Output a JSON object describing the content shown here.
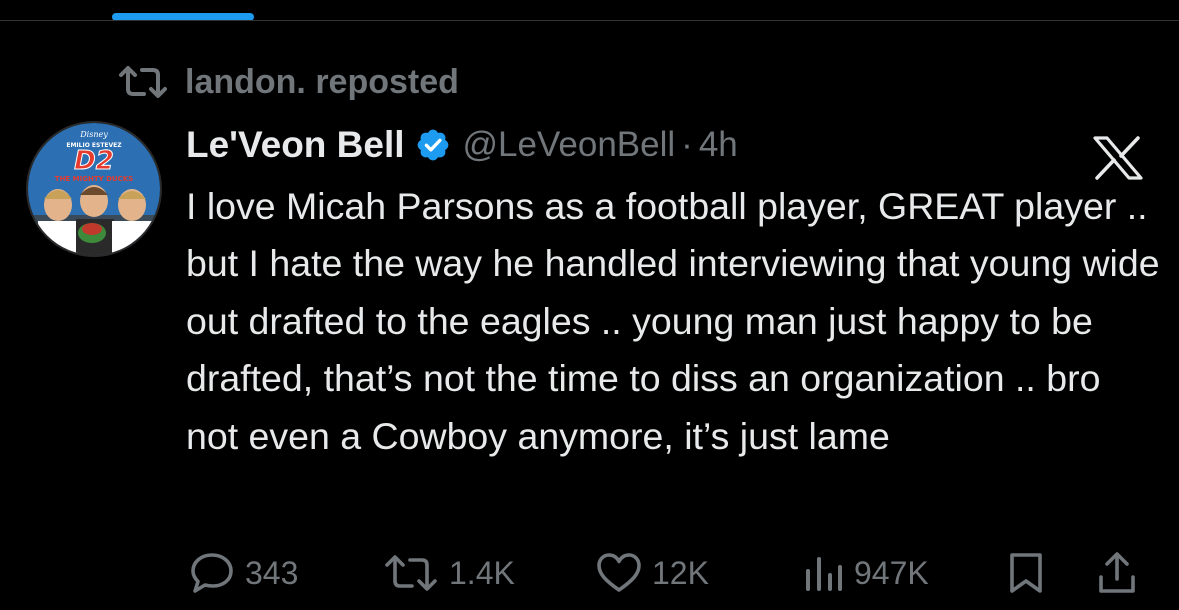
{
  "repost": {
    "text": "landon. reposted"
  },
  "post": {
    "display_name": "Le'Veon Bell",
    "handle": "@LeVeonBell",
    "separator": "·",
    "time": "4h",
    "verified": true,
    "text": "I love Micah Parsons as a football player, GREAT player .. but I hate the way he handled interviewing that young wide out drafted to the eagles .. young man just happy to be drafted, that’s not the time to diss an organization .. bro not even a Cowboy anymore, it’s just lame"
  },
  "avatar": {
    "poster_brand": "Disney",
    "poster_name": "EMILIO ESTEVEZ",
    "poster_title": "D2",
    "poster_subtitle": "THE MIGHTY DUCKS"
  },
  "stats": {
    "replies": "343",
    "reposts": "1.4K",
    "likes": "12K",
    "views": "947K"
  },
  "icons": {
    "repost": "repost-icon",
    "verified": "verified-badge-icon",
    "brand": "x-logo-icon",
    "reply": "reply-icon",
    "like": "heart-icon",
    "views": "views-icon",
    "bookmark": "bookmark-icon",
    "share": "share-icon"
  },
  "colors": {
    "background": "#000000",
    "text_primary": "#e7e9ea",
    "text_secondary": "#71767b",
    "accent": "#1d9bf0"
  }
}
